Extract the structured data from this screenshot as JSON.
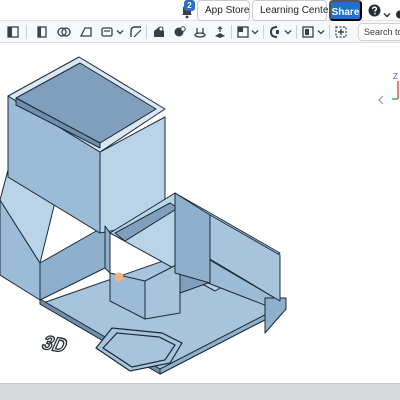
{
  "header": {
    "notification_count": "2",
    "app_store_label": "App Store",
    "learning_center_label": "Learning Center",
    "share_label": "Share"
  },
  "toolbar": {
    "search_placeholder": "Search tools"
  },
  "model": {
    "emblem_text": "3D",
    "surface_color": "#a7c4dc",
    "top_color": "#b9d3e8",
    "dark_color": "#6d8fac",
    "edge_color": "#1b2a38",
    "marker_color": "#f2b27a"
  },
  "colors": {
    "accent": "#1f6fd1",
    "badge": "#2f6fc6"
  }
}
